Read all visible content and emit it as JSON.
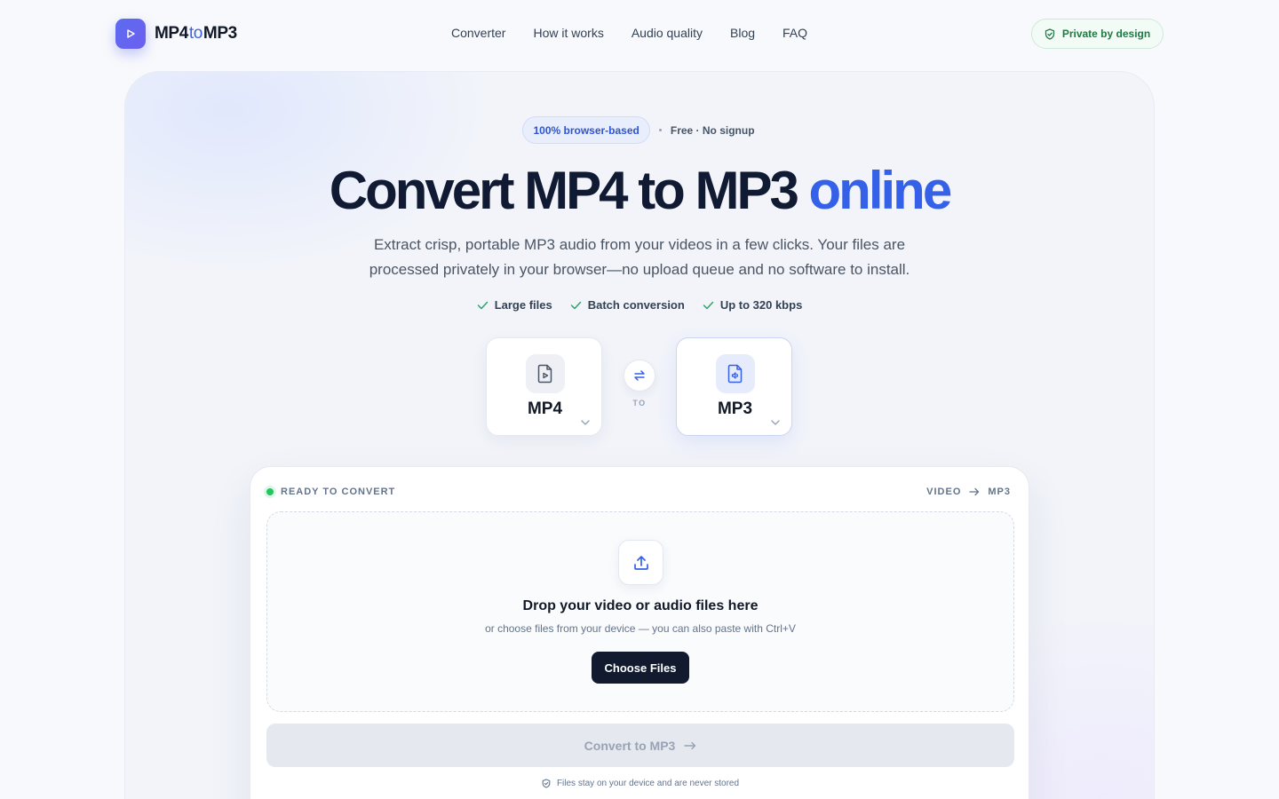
{
  "header": {
    "logo": {
      "prefix": "MP4",
      "middle": "to",
      "suffix": "MP3",
      "icon": "play-icon"
    },
    "nav": [
      "Converter",
      "How it works",
      "Audio quality",
      "Blog",
      "FAQ"
    ],
    "badge": {
      "label": "Private by design",
      "icon": "shield-check-icon"
    }
  },
  "hero": {
    "pill": "100% browser-based",
    "note": "Free · No signup",
    "title_main": "Convert MP4 to MP3",
    "title_accent": "online",
    "subtitle_line1": "Extract crisp, portable MP3 audio from your videos in a few clicks. Your files are",
    "subtitle_line2": "processed privately in your browser—no upload queue and no software to install.",
    "features": [
      "Large files",
      "Batch conversion",
      "Up to 320 kbps"
    ]
  },
  "formats": {
    "from": {
      "label": "MP4",
      "icon": "video-file-icon"
    },
    "to": {
      "label": "MP3",
      "icon": "audio-file-icon"
    },
    "swap_label": "TO"
  },
  "converter": {
    "status": "READY TO CONVERT",
    "route_from": "VIDEO",
    "route_to": "MP3",
    "drop_title": "Drop your video or audio files here",
    "drop_sub": "or choose files from your device — you can also paste with Ctrl+V",
    "choose_label": "Choose Files",
    "convert_label": "Convert to MP3",
    "footnote": "Files stay on your device and are never stored"
  },
  "colors": {
    "accent": "#3461e8",
    "brand": "#5b6cf0",
    "success": "#22c55e",
    "dark_button": "#111a2e"
  }
}
